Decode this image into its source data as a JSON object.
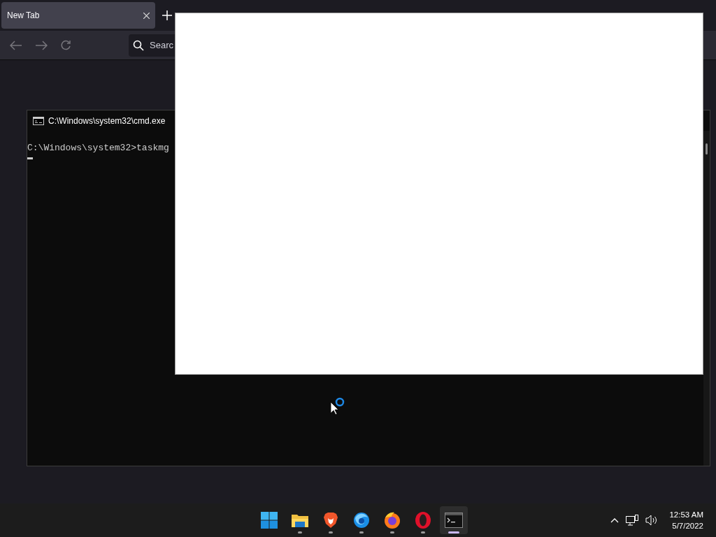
{
  "browser": {
    "tabs": [
      {
        "label": "New Tab",
        "selected": true
      }
    ],
    "search": {
      "placeholder": "Searc"
    }
  },
  "console_window": {
    "title": "C:\\Windows\\system32\\cmd.exe",
    "lines": [
      "C:\\Windows\\system32>taskmg"
    ]
  },
  "taskbar": {
    "apps": [
      {
        "kind": "start",
        "running": false,
        "active": false
      },
      {
        "kind": "folder",
        "running": true,
        "active": false
      },
      {
        "kind": "lion",
        "running": true,
        "active": false
      },
      {
        "kind": "bird",
        "running": true,
        "active": false
      },
      {
        "kind": "fox",
        "running": true,
        "active": false
      },
      {
        "kind": "ring",
        "running": true,
        "active": false
      },
      {
        "kind": "terminal",
        "running": true,
        "active": true
      }
    ],
    "clock": {
      "time": "12:53 AM",
      "date": "5/7/2022"
    }
  }
}
